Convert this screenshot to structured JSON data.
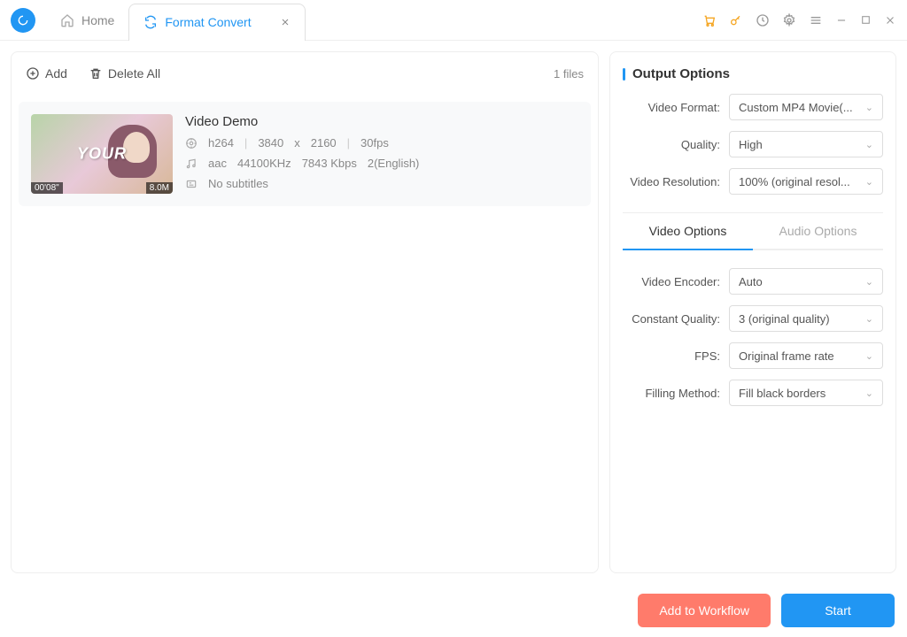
{
  "tabs": {
    "home": "Home",
    "convert": "Format Convert"
  },
  "toolbar": {
    "add": "Add",
    "delete_all": "Delete All",
    "file_count": "1 files"
  },
  "file": {
    "title": "Video Demo",
    "thumb_overlay": "YOUR",
    "duration": "00'08\"",
    "size": "8.0M",
    "vcodec": "h264",
    "width": "3840",
    "x": "x",
    "height": "2160",
    "fps": "30fps",
    "acodec": "aac",
    "sample": "44100KHz",
    "bitrate": "7843 Kbps",
    "lang": "2(English)",
    "subs": "No subtitles"
  },
  "output": {
    "title": "Output Options",
    "format_label": "Video Format:",
    "format_value": "Custom MP4 Movie(...",
    "quality_label": "Quality:",
    "quality_value": "High",
    "resolution_label": "Video Resolution:",
    "resolution_value": "100% (original resol..."
  },
  "subtabs": {
    "video": "Video Options",
    "audio": "Audio Options"
  },
  "video_opts": {
    "encoder_label": "Video Encoder:",
    "encoder_value": "Auto",
    "cq_label": "Constant Quality:",
    "cq_value": "3 (original quality)",
    "fps_label": "FPS:",
    "fps_value": "Original frame rate",
    "fill_label": "Filling Method:",
    "fill_value": "Fill black borders"
  },
  "footer": {
    "workflow": "Add to Workflow",
    "start": "Start"
  }
}
